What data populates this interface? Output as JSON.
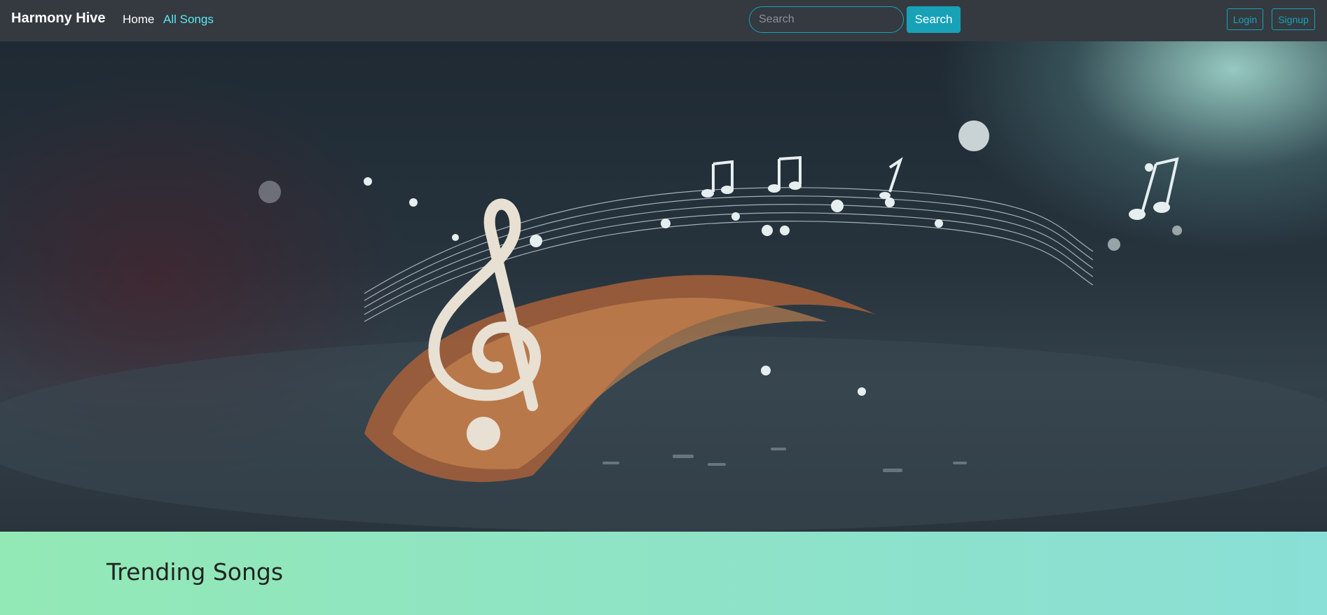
{
  "navbar": {
    "brand": "Harmony Hive",
    "links": [
      {
        "label": "Home",
        "active": true
      },
      {
        "label": "All Songs",
        "active": false
      }
    ],
    "search": {
      "placeholder": "Search",
      "value": "",
      "button_label": "Search"
    },
    "auth": {
      "login_label": "Login",
      "signup_label": "Signup"
    }
  },
  "hero": {
    "image_icon": "music-notes-treble-clef-image"
  },
  "trending": {
    "title": "Trending Songs"
  },
  "colors": {
    "navbar_bg": "#343a40",
    "accent": "#17a2b8",
    "link_active": "#5ce8f0",
    "section_bg": "#8fe6bf"
  }
}
